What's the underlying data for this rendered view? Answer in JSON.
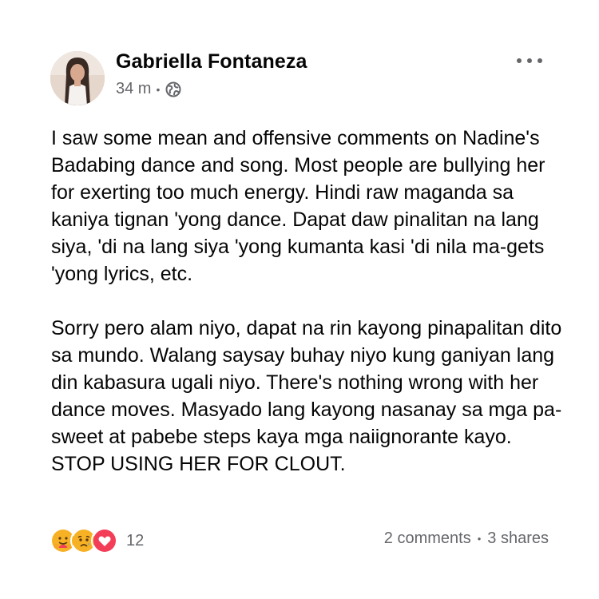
{
  "post": {
    "author": "Gabriella Fontaneza",
    "timestamp": "34 m",
    "meta_separator": "•",
    "privacy_icon": "globe-icon",
    "more_icon": "more-options-icon",
    "paragraphs": [
      "I saw some mean and offensive comments on Nadine's Badabing dance and song. Most people are bullying her for exerting too much energy. Hindi raw maganda sa kaniya tignan 'yong dance. Dapat daw pinalitan na lang siya, 'di na lang siya 'yong kumanta kasi 'di nila ma-gets 'yong lyrics, etc.",
      "Sorry pero alam niyo, dapat na rin kayong pinapalitan dito sa mundo. Walang saysay buhay niyo kung ganiyan lang din kabasura ugali niyo. There's nothing wrong with her dance moves. Masyado lang kayong nasanay sa mga pa-sweet at pabebe steps kaya mga naiignorante kayo. STOP USING HER FOR CLOUT."
    ],
    "reactions": {
      "icons": [
        "care-reaction-icon",
        "sad-reaction-icon",
        "love-reaction-icon"
      ],
      "count": "12"
    },
    "comments": "2 comments",
    "stats_separator": "•",
    "shares": "3 shares"
  },
  "colors": {
    "text": "#050505",
    "secondary": "#65676b",
    "love": "#f33e58",
    "reaction_yellow": "#f7b125"
  }
}
